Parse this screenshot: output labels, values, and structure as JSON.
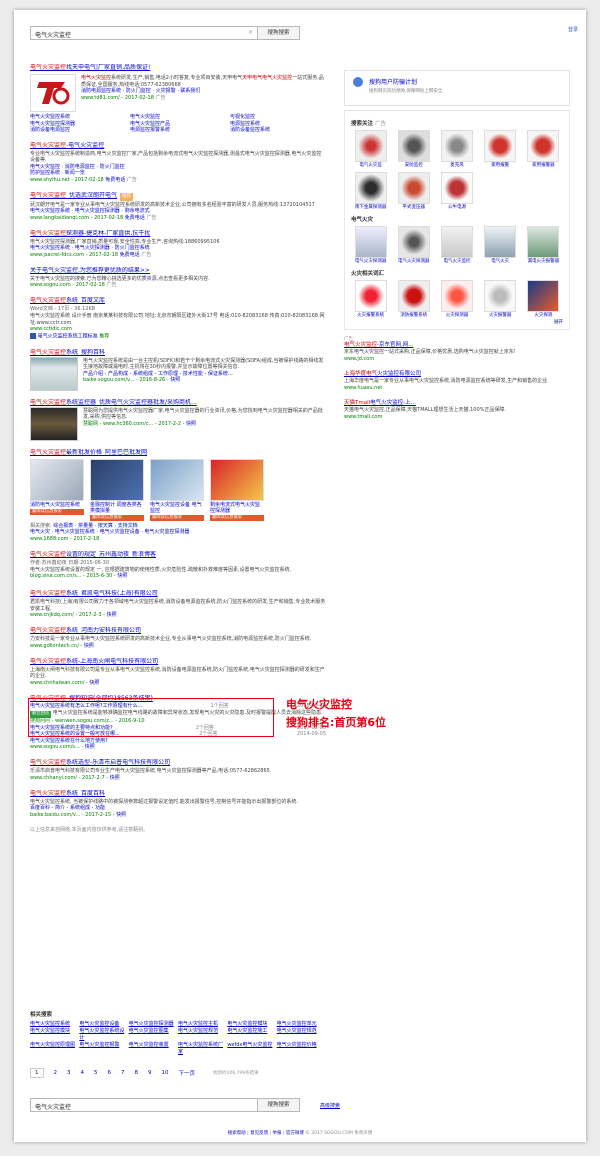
{
  "search": {
    "query": "电气火灾监控",
    "button": "搜狗搜索",
    "clear": "×"
  },
  "header": {
    "login": "登录"
  },
  "results": {
    "r1": {
      "title_hl": "电气火灾监控",
      "title_rest": "找天申电气|厂家直销,品质保证!",
      "desc_a": "电气火灾监控",
      "desc_b": "系统研发,生产,销售,电话2小时答复,专业项目安装,天申电气",
      "desc_c": "天申电气",
      "desc_d": "电气火灾监控",
      "desc_e": "一站式服务,品质保证,全国服务,热线电话:0577-62380668",
      "links": [
        "消防电源监控系统",
        "防火门监控",
        "火灾报警",
        "联系我们"
      ],
      "links2": [
        "电气火灾监控系统",
        "电气火灾监控",
        "可视化监控"
      ],
      "links3": [
        "电气火灾监控探测器",
        "电气火灾监控产品",
        "电源监控系统"
      ],
      "links4": [
        "消防设备电源监控",
        "电源监控报警系统",
        "消防设备监控系统"
      ],
      "url": "www.td81.com/",
      "date": "2017-02-18",
      "ad": "广告"
    },
    "r2": {
      "title_hl": "电气火灾监控",
      "title_rest": "-电气火灾监控",
      "desc": "专业电气火灾监控系统制造商,电气火灾监控厂家,产品包括剩余电流式电气火灾监控探测器,测温式电气火灾监控探测器,电气火灾监控设备等.",
      "links": [
        "电气火灾监控",
        "消防电源监控",
        "防火门监控"
      ],
      "links2": [
        "防护监控系统",
        "新闻一览"
      ],
      "url": "www.shyihu.net",
      "date": "2017-02-18",
      "phone": "免费电话",
      "ad": "广告"
    },
    "r3": {
      "title_hl": "电气火灾监控",
      "title_rest": "_优选武汉朗开电气",
      "tag": "推荐",
      "desc": "武汉朗开电气是一家专业从事电气火灾监控系统研发的高新技术企业,公司拥有多名经验丰富的研发人员,服务热线:13720104517",
      "links": [
        "电气火灾监控系统",
        "电气火灾监控探测器",
        "剩余电流式"
      ],
      "url": "www.langkaidianqi.com",
      "date": "2017-02-18",
      "phone": "免费电话",
      "ad": "广告"
    },
    "r4": {
      "title_hl": "电气火灾监控",
      "title_rest": "探测器-捷克林-厂家直供,抗干扰",
      "desc": "电气火灾监控探测器,厂家直销,质量可靠,安全性高,专业生产,咨询热线:18860995106",
      "links": [
        "电气火灾监控系统",
        "电气火灾探测器",
        "防火门监控系统"
      ],
      "url": "www.jsacrel-fdcs.com",
      "date": "2017-02-18",
      "phone": "免费电话",
      "ad": "广告"
    },
    "r5": {
      "title": "关于电气火灾监控,为您推荐更优质的结果>>",
      "desc": "关于电气火灾监控的搜索,已为您精心挑选更多的优质资源,点击查看更多相关内容.",
      "url": "www.sogou.com",
      "date": "2017-02-18",
      "ad": "广告"
    },
    "r6": {
      "title_hl": "电气火灾监控",
      "title_rest": "系统_百度文库",
      "meta": "Word文档 - 17页 - 36.12KB",
      "desc": "电气火灾监控系统 设计手册 南京某某科技有限公司 地址:北京市朝阳区建外大街17号 电话:010-82083168 传真:010-82083168 网址:www.cctr.com",
      "url": "www.cctidic.com",
      "sub": "电气火灾监控系统工程标准",
      "sub2": "推荐"
    },
    "r7": {
      "title_hl": "电气火灾监控",
      "title_rest": "系统_搜狗百科",
      "desc": "电气火灾监控系统是由一台主控机(SDFK)和若干个剩余电流式火灾探测器(SDFA)组成,当被保护线路的相线发生接地故障或漏电时,主机将在30秒内报警,并显示故障位置等相关信息.",
      "sublinks": "产品介绍 - 产品构成 - 系统组成 - 工作原理 - 技术性能 - 保证系统...",
      "url": "baike.sogou.com/v...",
      "date": "2016-8-26",
      "cache": "快照"
    },
    "r8": {
      "title_hl": "电气火灾监控",
      "title_rest": "系统监控器_优质电气火灾监控器批发/采购商机...",
      "desc": "慧聪网为您提供电气火灾监控器厂家,电气火灾监控器的行业资讯,价格,为您找到电气火灾监控器相关的产品批发,采购,供应等信息.",
      "sub": "慧聪网 - www.hc360.com/c...",
      "date": "2017-2-2",
      "cache": "快照"
    },
    "r9": {
      "title_hl": "电气火灾监控",
      "title_rest": "最新批发价格_阿里巴巴批发网",
      "items": [
        {
          "cap": "消防电气火灾监控系统",
          "btn": "赢阅读信息报装"
        },
        {
          "cap": "金融控制计 调度各类各类模拟量",
          "btn": "赢阅读信息报装"
        },
        {
          "cap": "电气火灾监控设备 电气监控",
          "btn": "赢阅读信息报装"
        },
        {
          "cap": "剩余电流式电气火灾监控探测器",
          "btn": "赢阅读信息报装"
        }
      ],
      "rel_label": "相关搜索:",
      "rel": [
        "综合报表",
        "拼量量",
        "按天算",
        "支持文档"
      ],
      "rel2": [
        "电气火灾",
        "电气火灾监控系统",
        "电气火灾监控设备",
        "电气火灾监控探测器"
      ],
      "url": "www.1688.com",
      "date": "2017-2-18"
    },
    "r10": {
      "title_hl": "电气火灾监控",
      "title_rest": "设置的规定_苏州鑫动夜_新浪博客",
      "meta": "作者:苏州鑫动夜 日期:2015-06-30",
      "desc": "电气火灾监控系统设置的规定 一, 应根据建筑物的使用性质,火灾危险性,疏散和扑救难度等因素,设置电气火灾监控系统.",
      "url": "blog.sina.com.cn/s...",
      "date": "2015-6-30",
      "cache": "快照"
    },
    "r11": {
      "title_hl": "电气火灾监控",
      "title_rest": "系统_君凯电气科技(上海)有限公司",
      "desc": "君凯电气科技(上海)有限公司致力于各领域电气火灾监控系统,消防设备电源监控系统,防火门监控系统的研发,生产和销售,专业技术服务安装工程.",
      "url": "www.cnjkdq.com/",
      "date": "2017-2-3",
      "cache": "快照"
    },
    "r12": {
      "title_hl": "电气火灾监控",
      "title_rest": "系统_河南力安科技有限公司",
      "desc": "力安科技是一家专业从事电气火灾监控系统研发的高新技术企业,专业从事电气火灾监控系统,消防电源监控系统,防火门监控系统.",
      "url": "www.gdliontech.cn/",
      "cache": "快照"
    },
    "r13": {
      "title_hl": "电气火灾监控",
      "title_rest": "系统-上海南火闸电气科技有限公司",
      "desc": "上海南火闸电气科技有限公司是专业从事电气火灾监控系统,消防设备电源监控系统,防火门监控系统,电气火灾监控探测器的研发和生产的企业.",
      "url": "www.chnhaiwan.com/",
      "cache": "快照"
    },
    "r14": {
      "title_hl": "电气火灾监控",
      "title_rest": "_搜狗知识(全部约18563条结果)",
      "qa": [
        {
          "q": "电气火灾监控系统有怎么工作呢?工作原理有什么...",
          "n": "1个回答",
          "d": "2016-09-18"
        },
        {
          "q": "电气火灾监控系统的主要特点和功能?",
          "n": "2个回答",
          "d": "2017-02-08"
        },
        {
          "q": "电气火灾监控系统的设置一般可放在哪...",
          "n": "2个回答",
          "d": "2014-09-05"
        },
        {
          "q": "电气火灾监控系统在什么地方使用?",
          "n": "",
          "d": ""
        }
      ],
      "best": "最佳回答",
      "best_text": "电气火灾监控系统是能够准确监控电气线路的故障和异常状态,发现电气火灾的火灾隐患,及时报警提醒人员去消除这些隐患.",
      "src": "搜狗问问 - wenwen.sogou.com/z...",
      "date": "2016-9-10",
      "url": "www.sogou.com/s...",
      "cache": "快照"
    },
    "r15": {
      "title_hl": "电气火灾监控",
      "title_rest": "系统选型-乐清市启普电气科技有限公司",
      "desc": "乐清市启普电气科技有限公司专业生产电气火灾监控系统,电气火灾监控探测器等产品,电话:0577-62862865",
      "url": "www.chhanyi.com/",
      "date": "2017-2-7",
      "cache": "快照"
    },
    "r16": {
      "title_hl": "电气火灾监控",
      "title_rest": "系统_百度百科",
      "desc": "电气火灾监控系统, 当被保护线路中的被探测参数超过报警设定值时,能发出报警信号,控制信号并能指示出报警部位的系统.",
      "sub": "百度百科 - 简介 - 系统组成 - 功能",
      "url": "baike.baidu.com/v...",
      "date": "2017-2-15",
      "cache": "快照"
    },
    "disclaimer": "以上信息来自网络,本页面内容仅供参考,请注意甄别。"
  },
  "annotation": {
    "line1": "电气火灾监控",
    "line2": "搜狗排名:首页第6位"
  },
  "related": {
    "title": "相关搜索",
    "items": [
      "电气火灾监控系统",
      "电气火灾监控设备",
      "电气火灾监控探测器",
      "电气火灾监控主机",
      "电气火灾监控模块",
      "电气火灾监控单元",
      "电气火灾监控模块",
      "电气火灾监控系统设计",
      "电气火灾监控图集",
      "电气火灾监控规范",
      "电气火灾监控施工",
      "电气火灾监控规范",
      "电气火灾监控原理图",
      "电气火灾监控报警",
      "电气火灾监控装置",
      "电气火灾监控系统厂家",
      "wefdx电气火灾监控",
      "电气火灾监控价格"
    ]
  },
  "pager": {
    "pages": [
      "1",
      "2",
      "3",
      "4",
      "5",
      "6",
      "7",
      "8",
      "9",
      "10"
    ],
    "next": "下一页",
    "total": "找到约108,799条结果"
  },
  "bottom": {
    "adv": "高级搜索"
  },
  "footer": {
    "links": [
      "搜索帮助",
      "意见反馈",
      "举报",
      "官方微博"
    ],
    "copy": "© 2017 SOGOU.COM 免责声明"
  },
  "sidebar": {
    "trust_title": "搜狗用户防骗计划",
    "trust_sub": "搜狗网页风险保障,保障网民上网安全",
    "sec1": "搜索关注",
    "sec1_tag": "广告",
    "p1": [
      "电气火灾监",
      "安防监控",
      "麦克风",
      "家用报警",
      "家用报警器"
    ],
    "p2": [
      "南下金属探测器",
      "平式变压器",
      "公牛电源"
    ],
    "sec2": "电气火灾",
    "p3": [
      "电气火灾探测器",
      "电气火灾探测器",
      "电气火灾监控",
      "电气火灾",
      "漏电火灾报警器"
    ],
    "sec3": "火灾相关词汇",
    "p4": [
      "火灾报警系统",
      "消防报警系统",
      "火灾探测器",
      "火灾报警器",
      "火灾探测"
    ],
    "more": "展开",
    "ad_tag": "广告",
    "ads": [
      {
        "t_hl": "电气火灾监控",
        "t_rest": "-京东官网,网...",
        "d": "京东电气火灾监控一站式采购,正品保障,价格优惠,选购电气火灾监控就上京东!",
        "u": "www.jd.com"
      },
      {
        "t_hl": "上海华度电气",
        "t_rest": "火灾监控有限公司",
        "d": "上海华度电气是一家专业从事电气火灾监控系统,消防电源监控系统等研发,生产和销售的企业.",
        "u": "www.huasu.net"
      },
      {
        "t_hl": "天猫Tmall",
        "t_rest": "电气火灾监控-上...",
        "d": "天猫电气火灾监控,正品保障,天猫TMALL理想生活上天猫,100%正品保障.",
        "u": "www.tmall.com"
      }
    ]
  }
}
